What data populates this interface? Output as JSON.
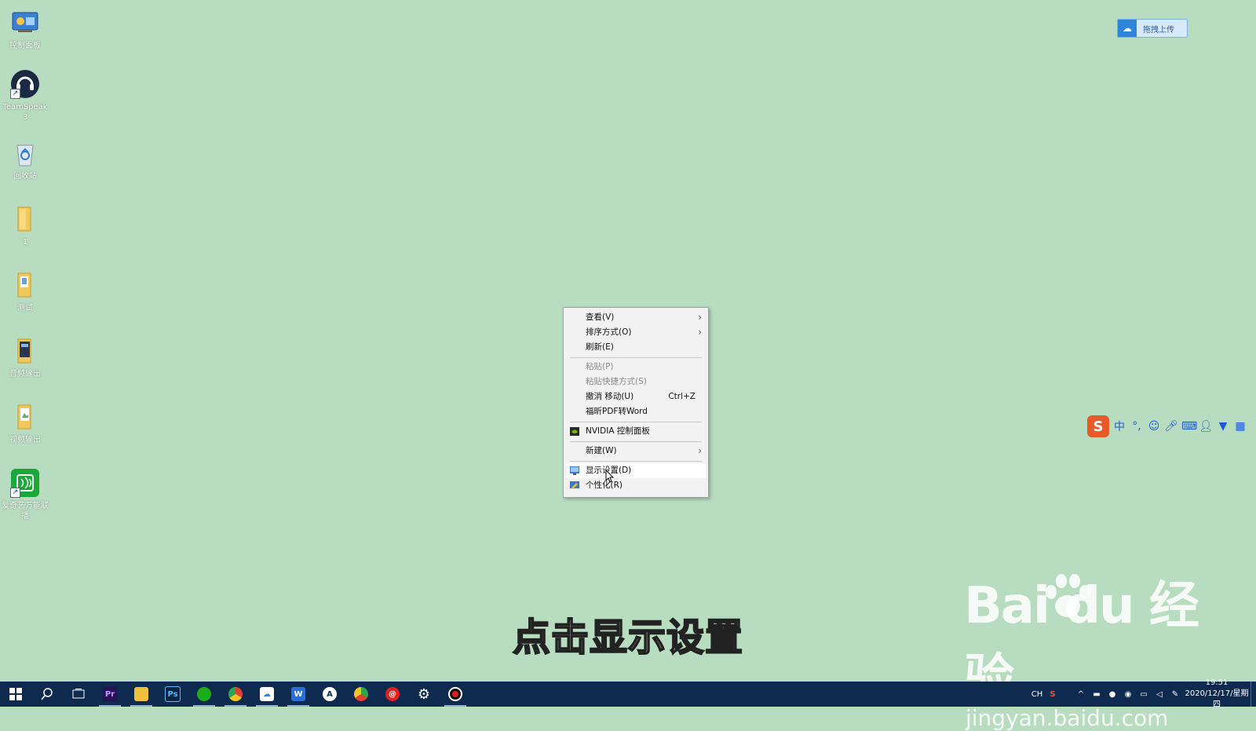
{
  "desktop": {
    "icons": [
      {
        "label": "控制面板",
        "icon": "control-panel-icon"
      },
      {
        "label": "TeamSpeak 3",
        "icon": "teamspeak-icon"
      },
      {
        "label": "回收站",
        "icon": "recycle-bin-icon"
      },
      {
        "label": "1",
        "icon": "folder-icon"
      },
      {
        "label": "测试",
        "icon": "folder-icon"
      },
      {
        "label": "音频输出",
        "icon": "folder-icon"
      },
      {
        "label": "视频输出",
        "icon": "folder-icon"
      },
      {
        "label": "爱奇艺万能联播",
        "icon": "iqiyi-icon"
      }
    ]
  },
  "upload_button": {
    "label": "拖拽上传",
    "icon": "cloud-icon"
  },
  "context_menu": {
    "items": [
      {
        "label": "查看(V)",
        "submenu": true
      },
      {
        "label": "排序方式(O)",
        "submenu": true
      },
      {
        "label": "刷新(E)"
      },
      {
        "label": "粘贴(P)",
        "disabled": true
      },
      {
        "label": "粘贴快捷方式(S)",
        "disabled": true
      },
      {
        "label": "撤消 移动(U)",
        "shortcut": "Ctrl+Z"
      },
      {
        "label": "福昕PDF转Word"
      },
      {
        "label": "NVIDIA 控制面板",
        "icon": "nvidia-icon"
      },
      {
        "label": "新建(W)",
        "submenu": true
      },
      {
        "label": "显示设置(D)",
        "icon": "display-icon",
        "highlighted": true
      },
      {
        "label": "个性化(R)",
        "icon": "personalize-icon"
      }
    ]
  },
  "ime_bar": {
    "logo": "S",
    "mode": "中",
    "punct": "°,"
  },
  "caption": "点击显示设置",
  "watermark": {
    "brand": "Bai du 经验",
    "url": "jingyan.baidu.com"
  },
  "taskbar": {
    "apps": [
      "Pr",
      "Ps"
    ],
    "tray": {
      "lang": "CH",
      "time": "19:51",
      "date": "2020/12/17/星期四"
    }
  },
  "colors": {
    "desktop": "#b8dcc0",
    "taskbar": "#0e2a4e",
    "menu_bg": "#f2f2f2",
    "highlight": "#ffffff"
  }
}
